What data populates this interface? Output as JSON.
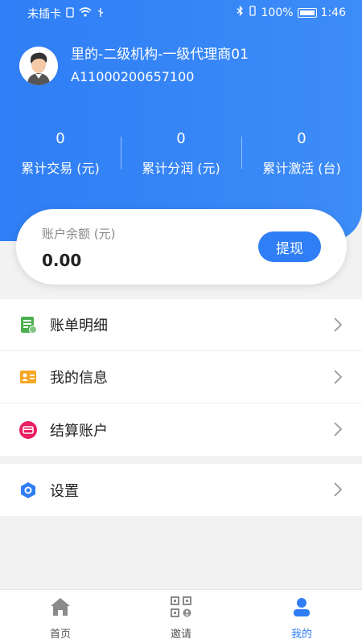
{
  "status_bar": {
    "carrier": "未插卡",
    "battery": "100%",
    "time": "1:46"
  },
  "profile": {
    "name": "里的-二级机构-一级代理商01",
    "id": "A11000200657100"
  },
  "stats": [
    {
      "value": "0",
      "label": "累计交易 (元)"
    },
    {
      "value": "0",
      "label": "累计分润 (元)"
    },
    {
      "value": "0",
      "label": "累计激活 (台)"
    }
  ],
  "balance": {
    "label": "账户余额 (元)",
    "value": "0.00",
    "withdraw_label": "提现"
  },
  "menu": {
    "items": [
      {
        "label": "账单明细",
        "icon": "bill-icon"
      },
      {
        "label": "我的信息",
        "icon": "id-card-icon"
      },
      {
        "label": "结算账户",
        "icon": "card-icon"
      }
    ],
    "settings": {
      "label": "设置",
      "icon": "settings-hex-icon"
    }
  },
  "tabbar": {
    "tabs": [
      {
        "label": "首页",
        "icon": "home-icon"
      },
      {
        "label": "邀请",
        "icon": "qrcode-icon"
      },
      {
        "label": "我的",
        "icon": "user-icon",
        "active": true
      }
    ]
  },
  "colors": {
    "primary": "#2f7ef5",
    "bill_icon": "#4caf50",
    "info_icon": "#f5a623",
    "card_icon": "#e91e63"
  }
}
